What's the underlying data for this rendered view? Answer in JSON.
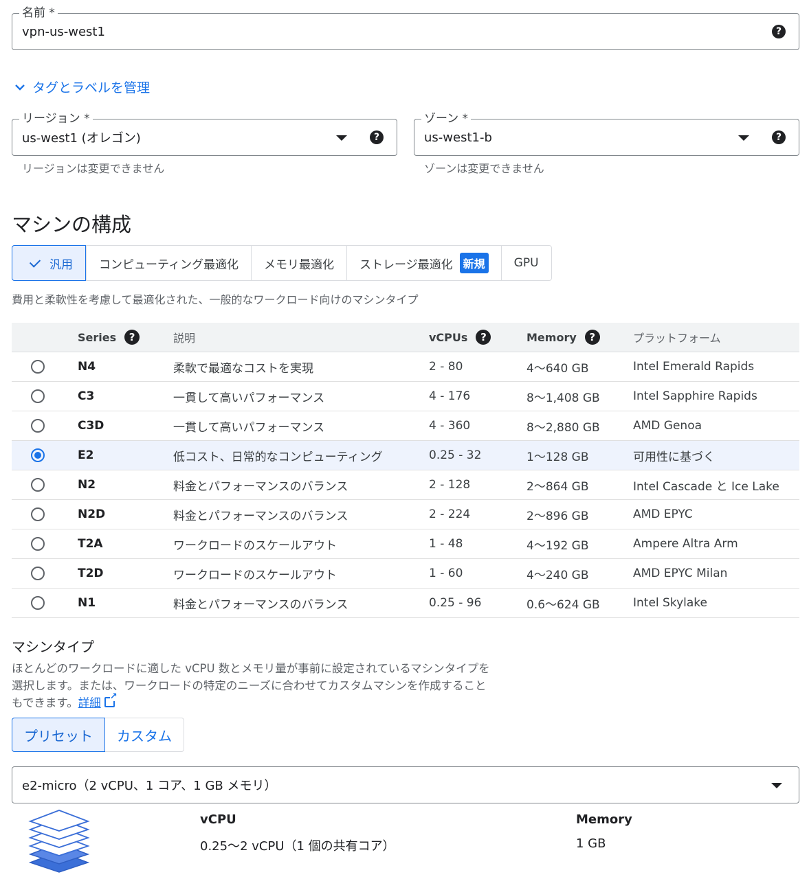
{
  "name_field": {
    "label": "名前 *",
    "value": "vpn-us-west1"
  },
  "tags_link": {
    "label": "タグとラベルを管理"
  },
  "region_field": {
    "label": "リージョン *",
    "value": "us-west1 (オレゴン)",
    "hint": "リージョンは変更できません"
  },
  "zone_field": {
    "label": "ゾーン *",
    "value": "us-west1-b",
    "hint": "ゾーンは変更できません"
  },
  "machine_config": {
    "title": "マシンの構成",
    "tabs": [
      {
        "label": "汎用",
        "active": true
      },
      {
        "label": "コンピューティング最適化"
      },
      {
        "label": "メモリ最適化"
      },
      {
        "label": "ストレージ最適化",
        "badge": "新規"
      },
      {
        "label": "GPU"
      }
    ],
    "description": "費用と柔軟性を考慮して最適化された、一般的なワークロード向けのマシンタイプ"
  },
  "series_table": {
    "headers": {
      "series": "Series",
      "description": "説明",
      "vcpus": "vCPUs",
      "memory": "Memory",
      "platform": "プラットフォーム"
    },
    "rows": [
      {
        "series": "N4",
        "description": "柔軟で最適なコストを実現",
        "vcpus": "2 - 80",
        "memory": "4～640 GB",
        "platform": "Intel Emerald Rapids",
        "selected": false
      },
      {
        "series": "C3",
        "description": "一貫して高いパフォーマンス",
        "vcpus": "4 - 176",
        "memory": "8～1,408 GB",
        "platform": "Intel Sapphire Rapids",
        "selected": false
      },
      {
        "series": "C3D",
        "description": "一貫して高いパフォーマンス",
        "vcpus": "4 - 360",
        "memory": "8～2,880 GB",
        "platform": "AMD Genoa",
        "selected": false
      },
      {
        "series": "E2",
        "description": "低コスト、日常的なコンピューティング",
        "vcpus": "0.25 - 32",
        "memory": "1～128 GB",
        "platform": "可用性に基づく",
        "selected": true
      },
      {
        "series": "N2",
        "description": "料金とパフォーマンスのバランス",
        "vcpus": "2 - 128",
        "memory": "2～864 GB",
        "platform": "Intel Cascade と Ice Lake",
        "selected": false
      },
      {
        "series": "N2D",
        "description": "料金とパフォーマンスのバランス",
        "vcpus": "2 - 224",
        "memory": "2～896 GB",
        "platform": "AMD EPYC",
        "selected": false
      },
      {
        "series": "T2A",
        "description": "ワークロードのスケールアウト",
        "vcpus": "1 - 48",
        "memory": "4～192 GB",
        "platform": "Ampere Altra Arm",
        "selected": false
      },
      {
        "series": "T2D",
        "description": "ワークロードのスケールアウト",
        "vcpus": "1 - 60",
        "memory": "4～240 GB",
        "platform": "AMD EPYC Milan",
        "selected": false
      },
      {
        "series": "N1",
        "description": "料金とパフォーマンスのバランス",
        "vcpus": "0.25 - 96",
        "memory": "0.6～624 GB",
        "platform": "Intel Skylake",
        "selected": false
      }
    ]
  },
  "machine_type": {
    "title": "マシンタイプ",
    "description_line1": "ほとんどのワークロードに適した vCPU 数とメモリ量が事前に設定されているマシンタイプを",
    "description_line2": "選択します。または、ワークロードの特定のニーズに合わせてカスタムマシンを作成すること",
    "description_line3": "もできます。",
    "learn_more": "詳細",
    "toggle": {
      "preset": "プリセット",
      "custom": "カスタム",
      "active": "preset"
    },
    "select_value": "e2-micro（2 vCPU、1 コア、1 GB メモリ）",
    "summary": {
      "vcpu_label": "vCPU",
      "vcpu_value": "0.25～2 vCPU（1 個の共有コア）",
      "memory_label": "Memory",
      "memory_value": "1 GB"
    }
  },
  "icons": [
    "help-icon",
    "chevron-down-icon",
    "dropdown-arrow-icon",
    "check-icon",
    "radio-icon",
    "external-link-icon",
    "layers-icon"
  ],
  "colors": {
    "accent": "#1a73e8",
    "selected_bg": "#e8f0fe",
    "table_head_bg": "#f1f3f4",
    "border": "#80868b"
  }
}
